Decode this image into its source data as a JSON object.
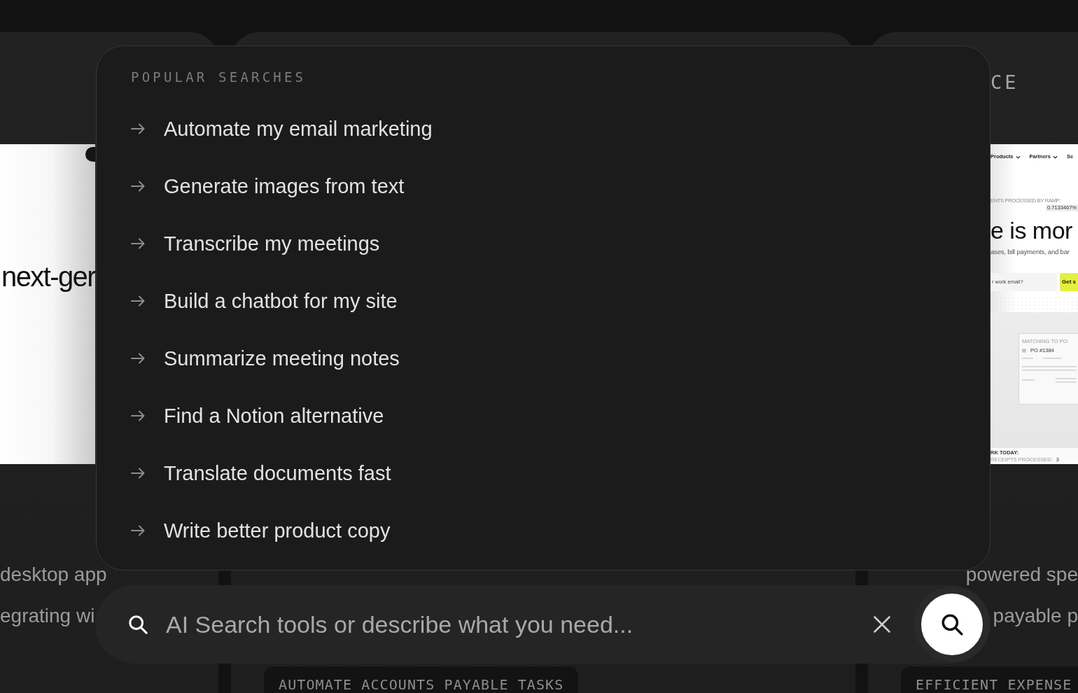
{
  "cards": [
    {
      "preview": {
        "kind": "headline",
        "headline": "next-ger"
      },
      "description": [
        "desktop app",
        "egrating wi"
      ]
    },
    {
      "tag": "AUTOMATE ACCOUNTS PAYABLE TASKS"
    },
    {
      "top_tag": "CE",
      "preview": {
        "kind": "website",
        "nav": [
          {
            "label": "Products",
            "dropdown": true
          },
          {
            "label": "Partners",
            "dropdown": true
          },
          {
            "label": "Sc",
            "dropdown": false
          }
        ],
        "stat_label": "ENTS PROCESSED BY RAMP:",
        "stat_value": "0.7133467%",
        "headline": "e is mor",
        "subline": "ases, bill payments, and bar",
        "email_placeholder": "r work email?",
        "cta": "Get s",
        "panel_label": "MATCHING TO PO:",
        "panel_item": "PO #1384",
        "footer": [
          "RK TODAY:",
          "RECEIPTS PROCESSED:",
          "3"
        ]
      },
      "description": [
        "powered spe",
        "payable p"
      ],
      "tag": "EFFICIENT EXPENSE"
    }
  ],
  "popular_searches": {
    "heading": "POPULAR SEARCHES",
    "items": [
      "Automate my email marketing",
      "Generate images from text",
      "Transcribe my meetings",
      "Build a chatbot for my site",
      "Summarize meeting notes",
      "Find a Notion alternative",
      "Translate documents fast",
      "Write better product copy"
    ]
  },
  "search_bar": {
    "placeholder": "AI Search tools or describe what you need..."
  }
}
